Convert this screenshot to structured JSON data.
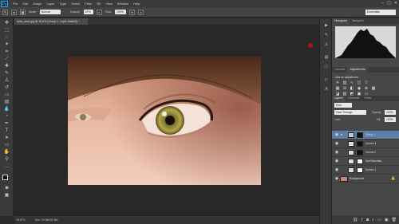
{
  "app": {
    "logo": "Ps"
  },
  "menu": [
    "File",
    "Edit",
    "Image",
    "Layer",
    "Type",
    "Select",
    "Filter",
    "3D",
    "View",
    "Window",
    "Help"
  ],
  "window_controls": [
    "–",
    "▢",
    "✕"
  ],
  "options": {
    "mode_label": "Mode:",
    "mode_value": "Normal",
    "opacity_label": "Opacity:",
    "opacity_value": "67%",
    "flow_label": "Flow:",
    "flow_value": "100%",
    "workspace": "Essentials"
  },
  "document": {
    "tab": "eyes_start.jpg @ 16.6% (Group 1, Layer Mask/8) *"
  },
  "status": {
    "zoom": "16.67%",
    "doc": "Doc: 31.8M/31.8M"
  },
  "panels": {
    "top_tabs": [
      "Histogram",
      "Navigator"
    ],
    "mid_tabs": [
      "Libraries",
      "Adjustments"
    ],
    "adjustments_title": "Add an adjustment",
    "layer_tabs": [
      "Layers",
      "Channels",
      "Paths"
    ]
  },
  "layer_controls": {
    "kind": "Kind",
    "blend": "Pass Through",
    "opacity_label": "Opacity:",
    "opacity": "100%",
    "lock_label": "Lock:",
    "fill_label": "Fill:",
    "fill": "100%"
  },
  "layers": [
    {
      "name": "Group 1",
      "selected": true,
      "mask": "dark"
    },
    {
      "name": "Curves 3",
      "selected": false,
      "mask": "dark"
    },
    {
      "name": "Curves 2",
      "selected": false,
      "mask": "dark"
    },
    {
      "name": "Hue/Saturatio...",
      "selected": false,
      "mask": "light"
    },
    {
      "name": "Curves 1",
      "selected": false,
      "mask": "light"
    },
    {
      "name": "Background",
      "selected": false,
      "mask": "none"
    }
  ],
  "colors": {
    "accent_selected": "#5d7ea6",
    "indicator": "#b01020"
  }
}
